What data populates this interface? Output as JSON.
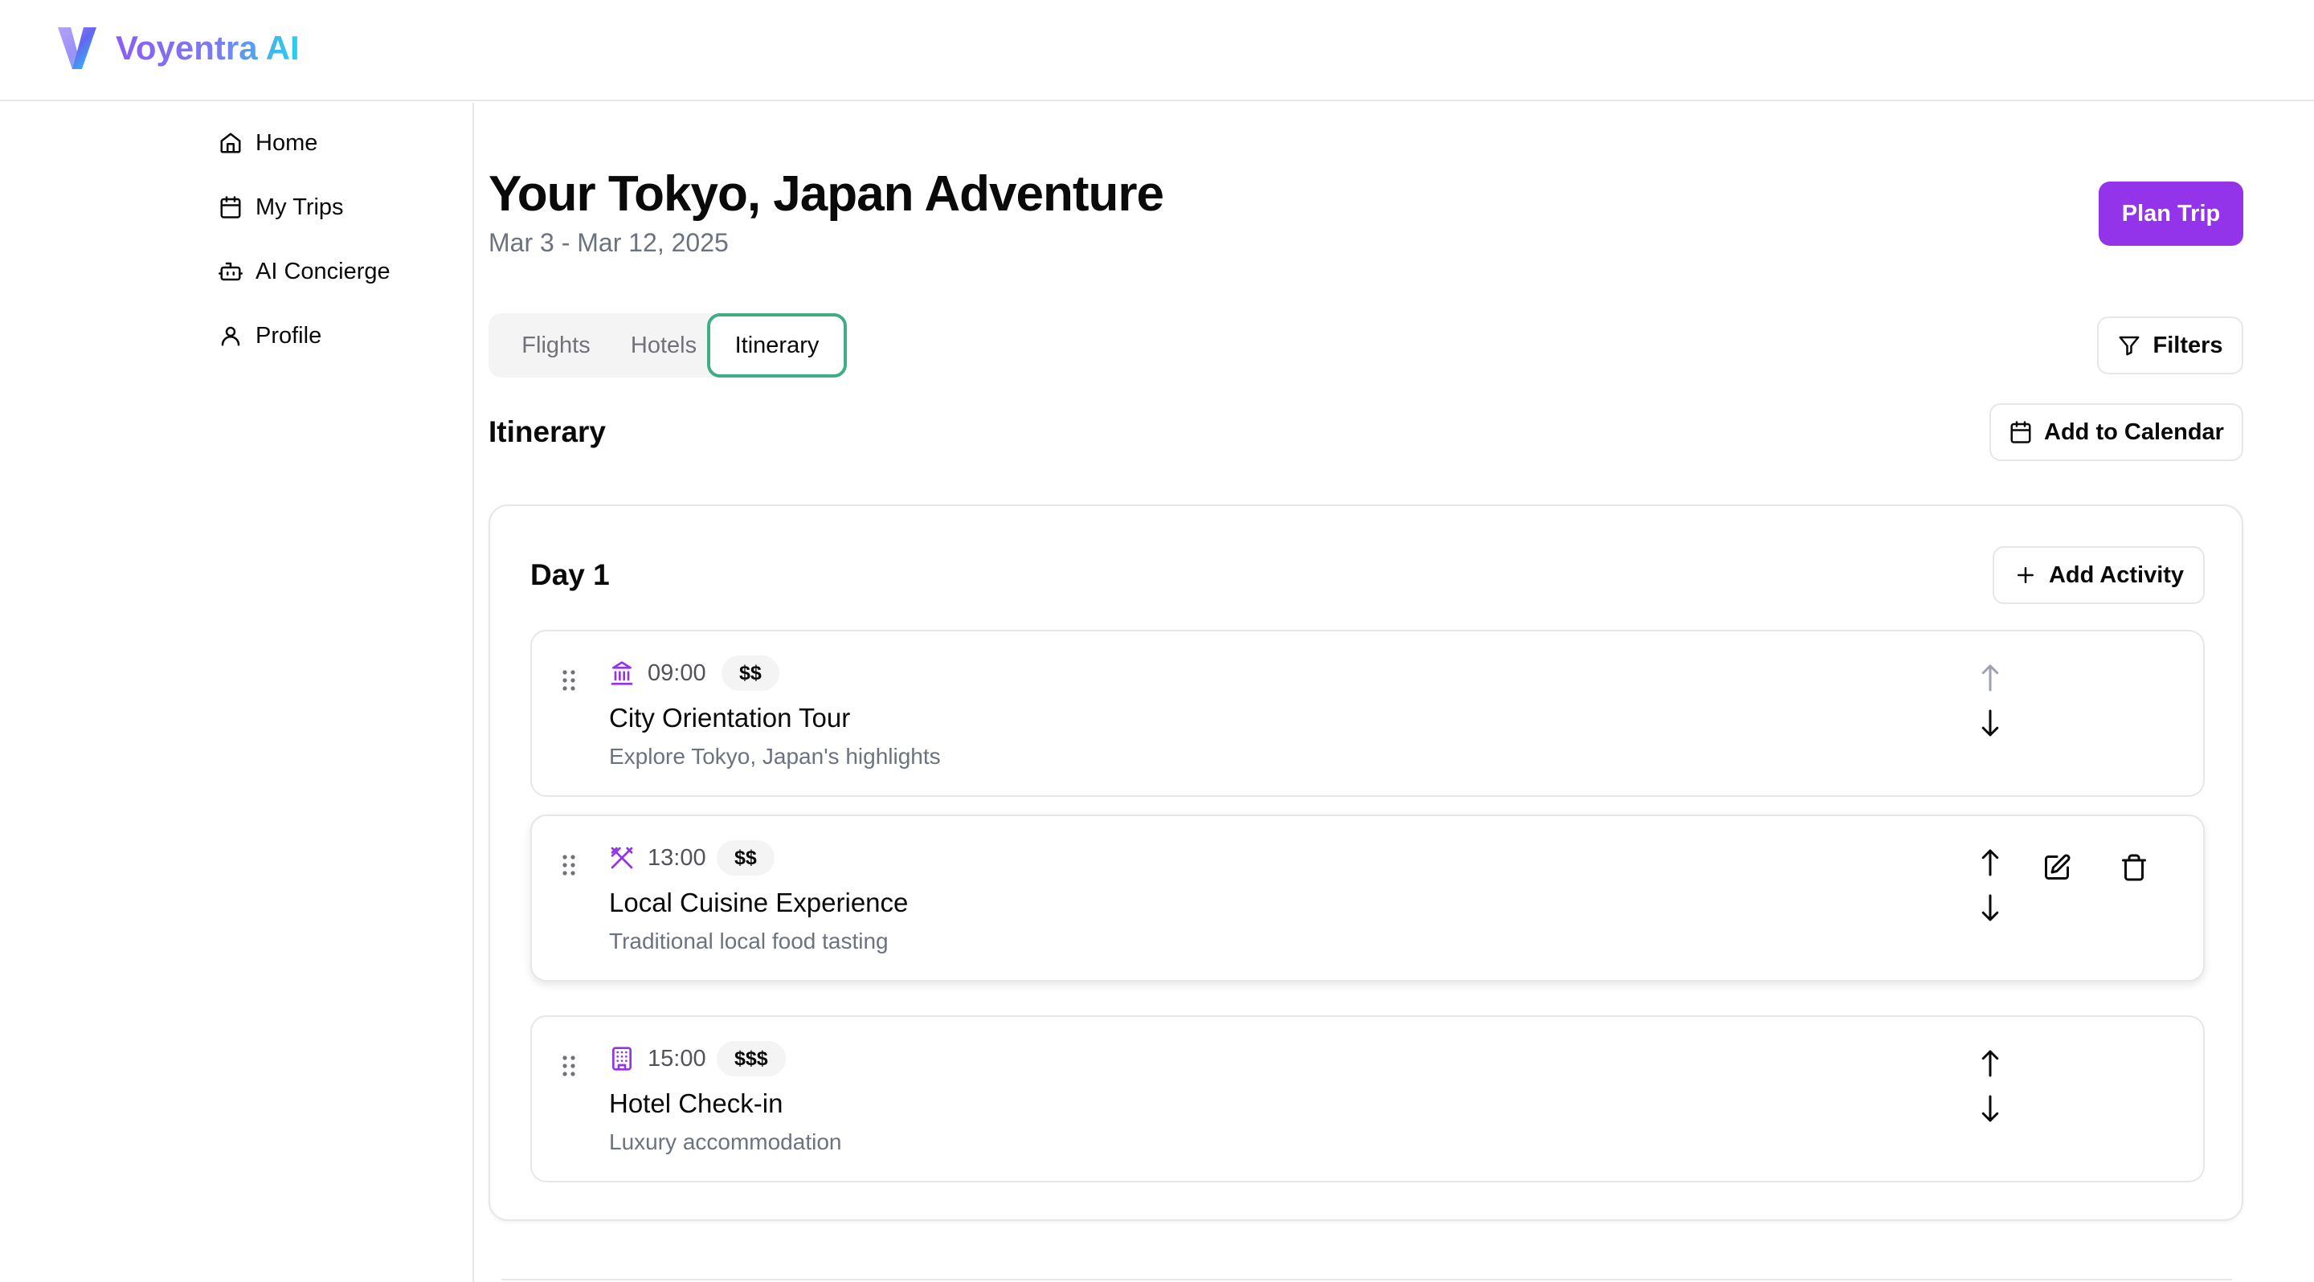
{
  "app": {
    "brand": "Voyentra AI",
    "colors": {
      "accent": "#9333ea",
      "active_tab_border": "#3fae84",
      "brand_gradient_start": "#8b5cf6",
      "brand_gradient_end": "#22d3ee"
    }
  },
  "sidebar": {
    "items": [
      {
        "label": "Home",
        "icon": "home-icon"
      },
      {
        "label": "My Trips",
        "icon": "calendar-icon"
      },
      {
        "label": "AI Concierge",
        "icon": "bot-icon"
      },
      {
        "label": "Profile",
        "icon": "user-icon"
      }
    ]
  },
  "header": {
    "title": "Your Tokyo, Japan Adventure",
    "dates": "Mar 3 - Mar 12, 2025",
    "plan_button": "Plan Trip"
  },
  "tabs": [
    {
      "label": "Flights",
      "active": false
    },
    {
      "label": "Hotels",
      "active": false
    },
    {
      "label": "Itinerary",
      "active": true
    }
  ],
  "toolbar": {
    "filters_label": "Filters",
    "add_calendar_label": "Add to Calendar"
  },
  "itinerary": {
    "title": "Itinerary",
    "days": [
      {
        "title": "Day 1",
        "add_activity_label": "Add Activity",
        "activities": [
          {
            "time": "09:00",
            "price": "$$",
            "name": "City Orientation Tour",
            "description": "Explore Tokyo, Japan's highlights",
            "icon": "landmark-icon"
          },
          {
            "time": "13:00",
            "price": "$$",
            "name": "Local Cuisine Experience",
            "description": "Traditional local food tasting",
            "icon": "utensils-icon"
          },
          {
            "time": "15:00",
            "price": "$$$",
            "name": "Hotel Check-in",
            "description": "Luxury accommodation",
            "icon": "building-icon"
          }
        ]
      }
    ]
  }
}
